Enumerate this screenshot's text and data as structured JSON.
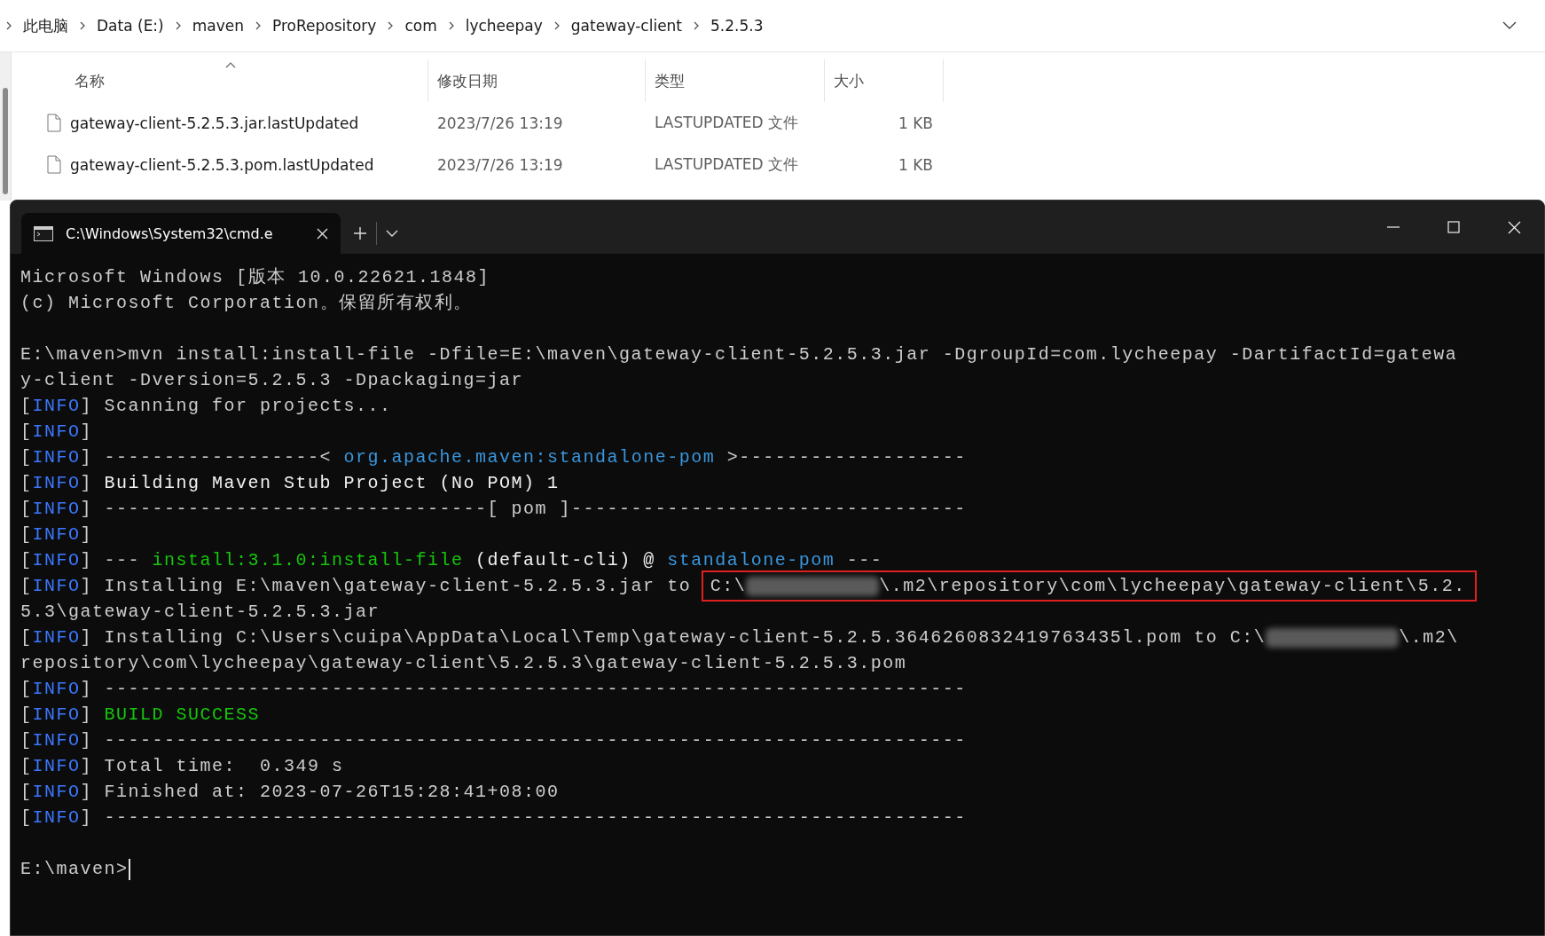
{
  "explorer": {
    "breadcrumb": [
      "此电脑",
      "Data (E:)",
      "maven",
      "ProRepository",
      "com",
      "lycheepay",
      "gateway-client",
      "5.2.5.3"
    ],
    "columns": [
      {
        "label": "名称",
        "sorted": true
      },
      {
        "label": "修改日期",
        "sorted": false
      },
      {
        "label": "类型",
        "sorted": false
      },
      {
        "label": "大小",
        "sorted": false
      }
    ],
    "files": [
      {
        "name": "gateway-client-5.2.5.3.jar.lastUpdated",
        "modified": "2023/7/26 13:19",
        "type": "LASTUPDATED 文件",
        "size": "1 KB"
      },
      {
        "name": "gateway-client-5.2.5.3.pom.lastUpdated",
        "modified": "2023/7/26 13:19",
        "type": "LASTUPDATED 文件",
        "size": "1 KB"
      }
    ]
  },
  "terminal": {
    "tab_title": "C:\\Windows\\System32\\cmd.e",
    "prompt_cursor": true,
    "lines": [
      {
        "segments": [
          {
            "kind": "plain",
            "text": "Microsoft Windows [版本 10.0.22621.1848]"
          }
        ]
      },
      {
        "segments": [
          {
            "kind": "plain",
            "text": "(c) Microsoft Corporation。保留所有权利。"
          }
        ]
      },
      {
        "kind": "blank"
      },
      {
        "segments": [
          {
            "kind": "plain",
            "text": "E:\\maven>mvn install:install-file -Dfile=E:\\maven\\gateway-client-5.2.5.3.jar -DgroupId=com.lycheepay -DartifactId=gatewa"
          }
        ]
      },
      {
        "segments": [
          {
            "kind": "plain",
            "text": "y-client -Dversion=5.2.5.3 -Dpackaging=jar"
          }
        ]
      },
      {
        "segments": [
          {
            "kind": "plain",
            "text": "["
          },
          {
            "kind": "info",
            "text": "INFO"
          },
          {
            "kind": "plain",
            "text": "] Scanning for projects..."
          }
        ]
      },
      {
        "segments": [
          {
            "kind": "plain",
            "text": "["
          },
          {
            "kind": "info",
            "text": "INFO"
          },
          {
            "kind": "plain",
            "text": "]"
          }
        ]
      },
      {
        "segments": [
          {
            "kind": "plain",
            "text": "["
          },
          {
            "kind": "info",
            "text": "INFO"
          },
          {
            "kind": "plain",
            "text": "] ------------------< "
          },
          {
            "kind": "link",
            "text": "org.apache.maven:standalone-pom"
          },
          {
            "kind": "plain",
            "text": " >-------------------"
          }
        ]
      },
      {
        "segments": [
          {
            "kind": "plain",
            "text": "["
          },
          {
            "kind": "info",
            "text": "INFO"
          },
          {
            "kind": "plain",
            "text": "] "
          },
          {
            "kind": "bright",
            "text": "Building Maven Stub Project (No POM) 1"
          }
        ]
      },
      {
        "segments": [
          {
            "kind": "plain",
            "text": "["
          },
          {
            "kind": "info",
            "text": "INFO"
          },
          {
            "kind": "plain",
            "text": "] --------------------------------[ pom ]---------------------------------"
          }
        ]
      },
      {
        "segments": [
          {
            "kind": "plain",
            "text": "["
          },
          {
            "kind": "info",
            "text": "INFO"
          },
          {
            "kind": "plain",
            "text": "]"
          }
        ]
      },
      {
        "segments": [
          {
            "kind": "plain",
            "text": "["
          },
          {
            "kind": "info",
            "text": "INFO"
          },
          {
            "kind": "plain",
            "text": "] --- "
          },
          {
            "kind": "green",
            "text": "install:3.1.0:install-file"
          },
          {
            "kind": "bright",
            "text": " (default-cli) @ "
          },
          {
            "kind": "link",
            "text": "standalone-pom"
          },
          {
            "kind": "plain",
            "text": " ---"
          }
        ]
      },
      {
        "segments": [
          {
            "kind": "plain",
            "text": "["
          },
          {
            "kind": "info",
            "text": "INFO"
          },
          {
            "kind": "plain",
            "text": "] Installing E:\\maven\\gateway-client-5.2.5.3.jar to "
          },
          {
            "kind": "boxed",
            "parts": [
              {
                "kind": "plain",
                "text": "C:\\"
              },
              {
                "kind": "redacted"
              },
              {
                "kind": "plain",
                "text": "\\.m2\\repository\\com\\lycheepay\\gateway-client\\5.2."
              }
            ]
          }
        ]
      },
      {
        "segments": [
          {
            "kind": "plain",
            "text": "5.3\\gateway-client-5.2.5.3.jar"
          }
        ]
      },
      {
        "segments": [
          {
            "kind": "plain",
            "text": "["
          },
          {
            "kind": "info",
            "text": "INFO"
          },
          {
            "kind": "plain",
            "text": "] Installing C:\\Users\\cuipa\\AppData\\Local\\Temp\\gateway-client-5.2.5.3646260832419763435l.pom to C:\\"
          },
          {
            "kind": "redacted"
          },
          {
            "kind": "plain",
            "text": "\\.m2\\"
          }
        ]
      },
      {
        "segments": [
          {
            "kind": "plain",
            "text": "repository\\com\\lycheepay\\gateway-client\\5.2.5.3\\gateway-client-5.2.5.3.pom"
          }
        ]
      },
      {
        "segments": [
          {
            "kind": "plain",
            "text": "["
          },
          {
            "kind": "info",
            "text": "INFO"
          },
          {
            "kind": "plain",
            "text": "] ------------------------------------------------------------------------"
          }
        ]
      },
      {
        "segments": [
          {
            "kind": "plain",
            "text": "["
          },
          {
            "kind": "info",
            "text": "INFO"
          },
          {
            "kind": "plain",
            "text": "] "
          },
          {
            "kind": "green",
            "text": "BUILD SUCCESS"
          }
        ]
      },
      {
        "segments": [
          {
            "kind": "plain",
            "text": "["
          },
          {
            "kind": "info",
            "text": "INFO"
          },
          {
            "kind": "plain",
            "text": "] ------------------------------------------------------------------------"
          }
        ]
      },
      {
        "segments": [
          {
            "kind": "plain",
            "text": "["
          },
          {
            "kind": "info",
            "text": "INFO"
          },
          {
            "kind": "plain",
            "text": "] Total time:  0.349 s"
          }
        ]
      },
      {
        "segments": [
          {
            "kind": "plain",
            "text": "["
          },
          {
            "kind": "info",
            "text": "INFO"
          },
          {
            "kind": "plain",
            "text": "] Finished at: 2023-07-26T15:28:41+08:00"
          }
        ]
      },
      {
        "segments": [
          {
            "kind": "plain",
            "text": "["
          },
          {
            "kind": "info",
            "text": "INFO"
          },
          {
            "kind": "plain",
            "text": "] ------------------------------------------------------------------------"
          }
        ]
      },
      {
        "kind": "blank"
      },
      {
        "segments": [
          {
            "kind": "plain",
            "text": "E:\\maven>"
          }
        ]
      }
    ]
  }
}
